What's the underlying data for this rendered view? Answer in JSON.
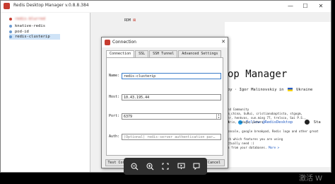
{
  "window": {
    "title": "Redis Desktop Manager v.0.8.8.384",
    "minimize": "—",
    "maximize": "☐",
    "close": "✕"
  },
  "connections": [
    {
      "label": "redis-blurred",
      "blurred": true
    },
    {
      "label": "knative-redis"
    },
    {
      "label": "pod-id"
    },
    {
      "label": "redis-clusterip",
      "selected": true
    }
  ],
  "tab": {
    "label": "RDM",
    "close": "⊠"
  },
  "welcome": {
    "title": "op Manager",
    "author": "by · Igor Malinovskiy in",
    "country": "Ukraine",
    "follow": "Follow @RedisDesktop",
    "github_prefix": "Sta",
    "left_stub": "t",
    "community_header": "nd Community",
    "community_lines": [
      "m_china, GuRui, cristianobaptista, stgogm,",
      "hr, henkvos, sun.ming 77, trelsco, Sai P.S.,",
      "arin, rodogu, peters"
    ],
    "tech_line": "onsole, google breakpad, Redis logo and other great",
    "features_intro": "ch which features you are using",
    "features_1": "ctually need :)",
    "features_2_prefix": "a from your databases.",
    "more_link": "More >"
  },
  "dialog": {
    "title": "Connection",
    "close": "✕",
    "tabs": [
      "Connection",
      "SSL",
      "SSH Tunnel",
      "Advanced Settings"
    ],
    "name_label": "Name:",
    "name_value": "redis-clusterip",
    "host_label": "Host:",
    "host_value": "10.43.195.44",
    "port_label": "Port:",
    "port_value": "6379",
    "auth_label": "Auth:",
    "auth_placeholder": "(Optional) redis-server authentication par…",
    "test_button": "Test Conn",
    "cancel_button": "Cancel"
  },
  "viewer_toolbar": {
    "icons": [
      "zoom-out-icon",
      "zoom-in-icon",
      "fit-screen-icon",
      "slideshow-icon",
      "comment-icon"
    ]
  },
  "watermark": "激活 W"
}
